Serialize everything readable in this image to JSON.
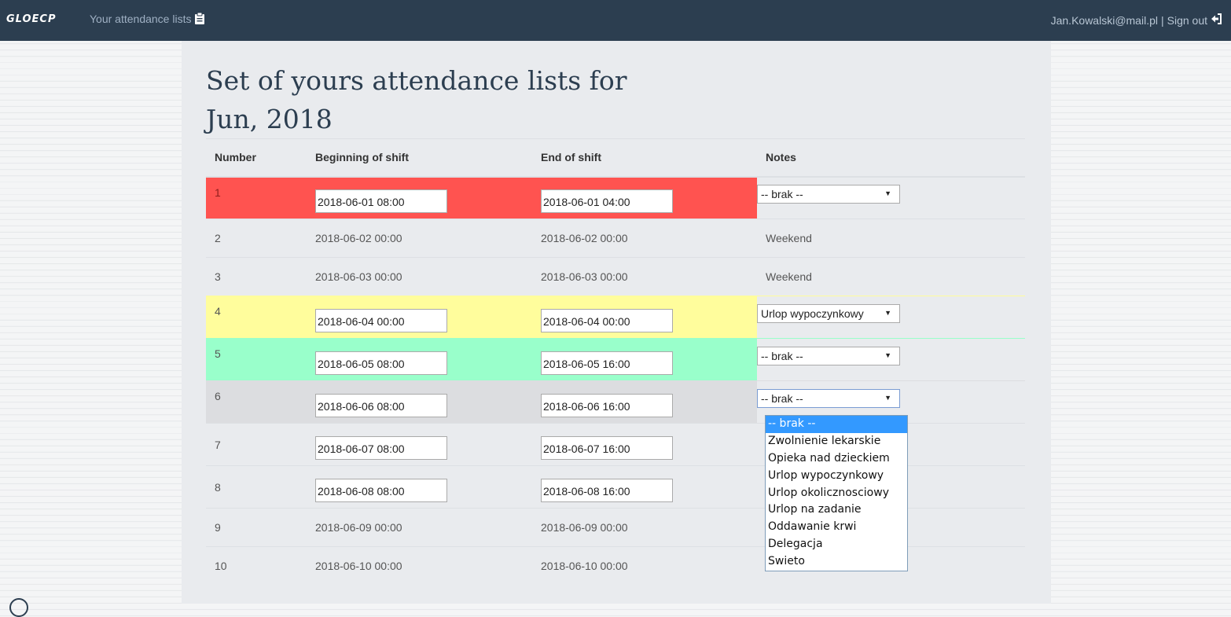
{
  "nav": {
    "brand": "GLOECP",
    "link_label": "Your attendance lists",
    "link_icon": "clipboard-icon",
    "user_email": "Jan.Kowalski@mail.pl",
    "separator": "|",
    "signout_label": "Sign out",
    "signout_icon": "sign-out-icon"
  },
  "page": {
    "title_line1": "Set of yours attendance lists for",
    "title_line2": "Jun, 2018"
  },
  "table": {
    "headers": [
      "Number",
      "Beginning of shift",
      "End of shift",
      "Notes"
    ],
    "rows": [
      {
        "number": "1",
        "start": "2018-06-01 08:00",
        "end": "2018-06-01 04:00",
        "note": "-- brak --",
        "state": "red"
      },
      {
        "number": "2",
        "start": "2018-06-02 00:00",
        "end": "2018-06-02 00:00",
        "note": "Weekend",
        "state": "static"
      },
      {
        "number": "3",
        "start": "2018-06-03 00:00",
        "end": "2018-06-03 00:00",
        "note": "Weekend",
        "state": "static"
      },
      {
        "number": "4",
        "start": "2018-06-04 00:00",
        "end": "2018-06-04 00:00",
        "note": "Urlop wypoczynkowy",
        "state": "yellow"
      },
      {
        "number": "5",
        "start": "2018-06-05 08:00",
        "end": "2018-06-05 16:00",
        "note": "-- brak --",
        "state": "green"
      },
      {
        "number": "6",
        "start": "2018-06-06 08:00",
        "end": "2018-06-06 16:00",
        "note": "-- brak --",
        "state": "gray"
      },
      {
        "number": "7",
        "start": "2018-06-07 08:00",
        "end": "2018-06-07 16:00",
        "note": "",
        "state": "plain"
      },
      {
        "number": "8",
        "start": "2018-06-08 08:00",
        "end": "2018-06-08 16:00",
        "note": "",
        "state": "plain"
      },
      {
        "number": "9",
        "start": "2018-06-09 00:00",
        "end": "2018-06-09 00:00",
        "note": "",
        "state": "static"
      },
      {
        "number": "10",
        "start": "2018-06-10 00:00",
        "end": "2018-06-10 00:00",
        "note": "Weekend",
        "state": "static"
      }
    ]
  },
  "dropdown_options": [
    "-- brak --",
    "Zwolnienie lekarskie",
    "Opieka nad dzieckiem",
    "Urlop wypoczynkowy",
    "Urlop okolicznosciowy",
    "Urlop na zadanie",
    "Oddawanie krwi",
    "Delegacja",
    "Swieto"
  ],
  "dropdown_selected": "-- brak --",
  "colors": {
    "navbar": "#2c3e50",
    "row_invalid": "#ff5350",
    "row_holiday": "#fffd9c",
    "row_ok": "#99ffcb",
    "row_active": "#dcdde0",
    "option_highlight": "#3399ff"
  }
}
